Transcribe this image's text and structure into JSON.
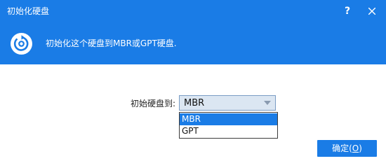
{
  "window": {
    "title": "初始化硬盘",
    "help_label": "?",
    "close_icon": "close-icon"
  },
  "header": {
    "icon": "disk-initialize-icon",
    "description": "初始化这个硬盘到MBR或GPT硬盘."
  },
  "form": {
    "label": "初始硬盘到:",
    "selected_value": "MBR",
    "options": [
      "MBR",
      "GPT"
    ],
    "highlighted_option": "MBR"
  },
  "footer": {
    "ok_text": "确定(",
    "ok_accel": "O",
    "ok_close": ")"
  },
  "colors": {
    "accent": "#1a7ce6",
    "select_bg": "#dbe6f2"
  }
}
